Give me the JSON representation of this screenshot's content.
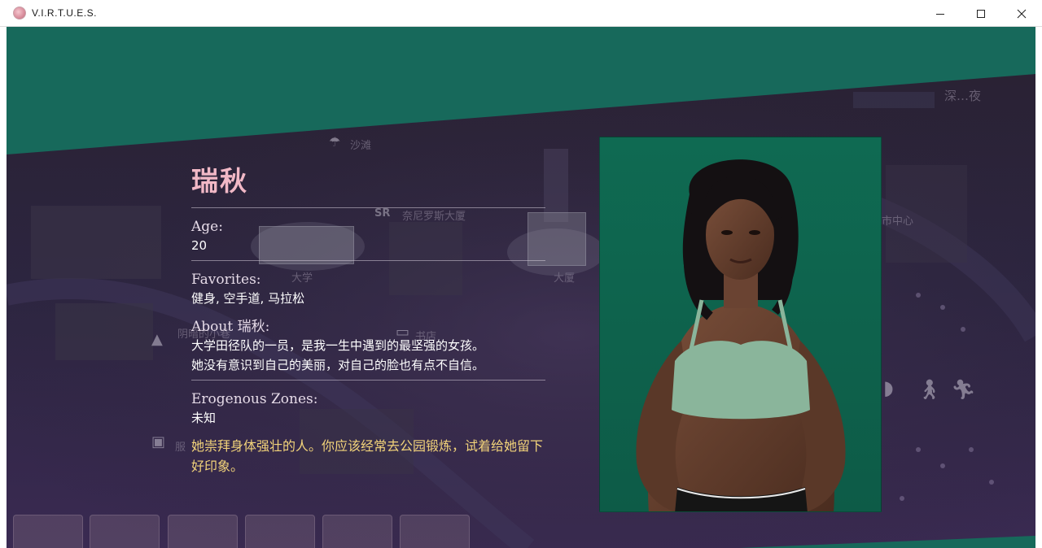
{
  "window": {
    "title": "V.I.R.T.U.E.S.",
    "minimize_icon": "minimize-icon",
    "maximize_icon": "maximize-icon",
    "close_icon": "close-icon"
  },
  "map": {
    "labels": [
      "沙滩",
      "奈尼罗斯大厦",
      "大学",
      "大厦",
      "市中心",
      "阴暗的小巷",
      "书店",
      "服",
      "深…夜"
    ],
    "sr_logo": "SR",
    "icons": [
      "umbrella-icon",
      "bus-icon",
      "walk-icon",
      "run-icon",
      "up-arrow-icon",
      "shirt-icon",
      "book-icon"
    ]
  },
  "character": {
    "name": "瑞秋",
    "age_label": "Age:",
    "age": "20",
    "favorites_label": "Favorites:",
    "favorites": "健身, 空手道, 马拉松",
    "about_label": "About 瑞秋:",
    "about_line1": "大学田径队的一员，是我一生中遇到的最坚强的女孩。",
    "about_line2": "她没有意识到自己的美丽，对自己的脸也有点不自信。",
    "zones_label": "Erogenous Zones:",
    "zones": "未知",
    "hint_line1": "她崇拜身体强壮的人。你应该经常去公园锻炼，试着给她留下",
    "hint_line2": "好印象。"
  },
  "colors": {
    "teal": "#17695b",
    "night_purple": "#2e2540",
    "name_pink": "#f1b8c6",
    "hint_yellow": "#f2d37a",
    "portrait_green": "#0f6a52"
  }
}
